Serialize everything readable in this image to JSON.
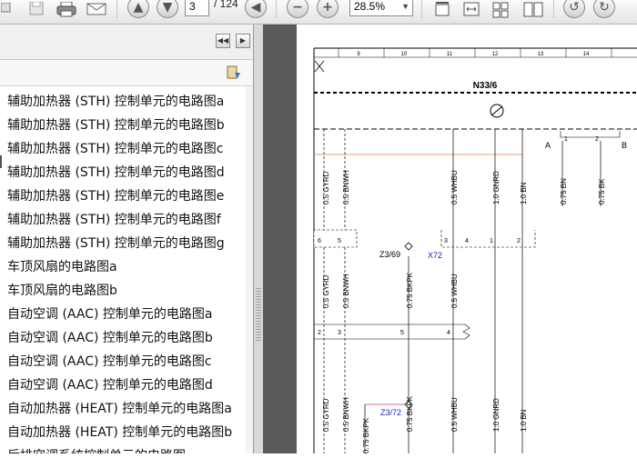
{
  "toolbar": {
    "current_page": "3",
    "total_pages": "/ 124",
    "zoom": "28.5%",
    "zoom_dropdown_arrow": "▼"
  },
  "sidebar": {
    "bookmarks": [
      "辅助加热器 (STH) 控制单元的电路图a",
      "辅助加热器 (STH) 控制单元的电路图b",
      "辅助加热器 (STH) 控制单元的电路图c",
      "辅助加热器 (STH) 控制单元的电路图d",
      "辅助加热器 (STH) 控制单元的电路图e",
      "辅助加热器 (STH) 控制单元的电路图f",
      "辅助加热器 (STH) 控制单元的电路图g",
      "车顶风扇的电路图a",
      "车顶风扇的电路图b",
      "自动空调 (AAC) 控制单元的电路图a",
      "自动空调 (AAC) 控制单元的电路图b",
      "自动空调 (AAC) 控制单元的电路图c",
      "自动空调 (AAC) 控制单元的电路图d",
      "自动加热器 (HEAT) 控制单元的电路图a",
      "自动加热器 (HEAT) 控制单元的电路图b",
      "后排空调系统控制单元的电路图"
    ]
  },
  "diagram": {
    "columns": [
      "9",
      "10",
      "11",
      "12",
      "13",
      "14"
    ],
    "component": "N33/6",
    "connector_a": "A",
    "connector_b": "B",
    "pin_labels": [
      "1",
      "2",
      "6",
      "5",
      "3",
      "4",
      "1",
      "2",
      "2",
      "3",
      "5",
      "4"
    ],
    "wires_top": [
      "0.5 GYRD",
      "0.5 BNWH",
      "0.5 WHBU",
      "1.0 GNRD",
      "1.0 BN",
      "0.75 BN",
      "0.75 BK"
    ],
    "wires_mid": [
      "0.5 GYRD",
      "0.5 BNWH",
      "0.75 BKPK",
      "0.5 WHBU"
    ],
    "wires_bot": [
      "0.5 GYRD",
      "0.5 BNWH",
      "0.75 BKPK",
      "0.75 BKPK",
      "0.5 WHBU",
      "1.0 GNRD",
      "1.0 BN"
    ],
    "node1": "Z3/69",
    "connector_x72": "X72",
    "node2": "Z3/72"
  }
}
